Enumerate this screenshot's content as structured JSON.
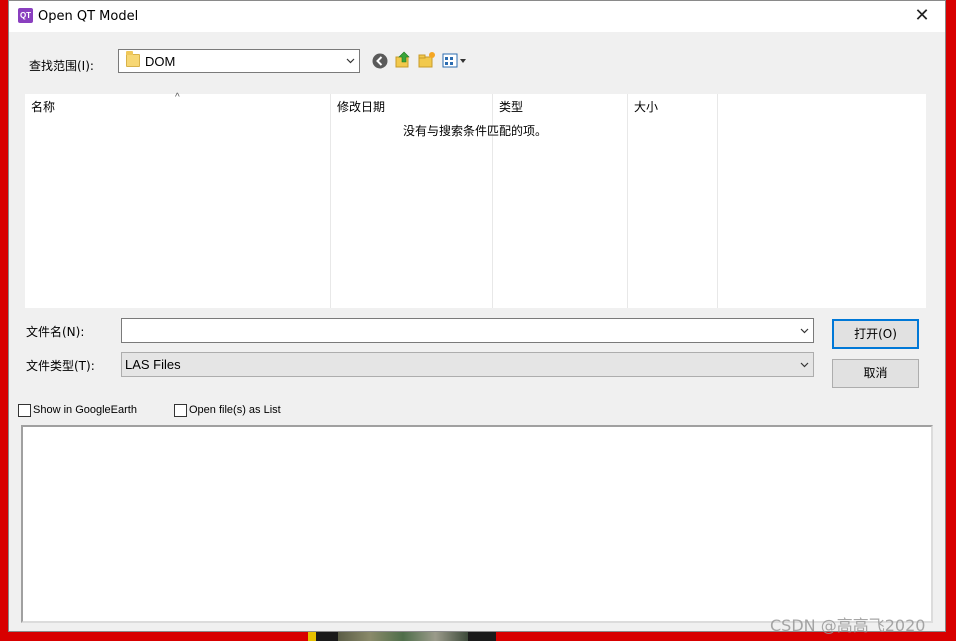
{
  "window": {
    "title": "Open QT Model",
    "app_icon_text": "QT",
    "close_glyph": "✕"
  },
  "lookin": {
    "label": "查找范围(I):",
    "value": "DOM"
  },
  "toolbar": {
    "icons": [
      "back-icon",
      "up-folder-icon",
      "new-folder-icon",
      "view-menu-icon"
    ]
  },
  "file_list": {
    "columns": [
      "名称",
      "修改日期",
      "类型",
      "大小"
    ],
    "empty_message": "没有与搜索条件匹配的项。"
  },
  "filename": {
    "label": "文件名(N):",
    "value": ""
  },
  "filetype": {
    "label": "文件类型(T):",
    "value": "LAS Files"
  },
  "buttons": {
    "open": "打开(O)",
    "cancel": "取消"
  },
  "options": {
    "google_earth": "Show in GoogleEarth",
    "as_list": "Open file(s) as List"
  },
  "watermark": "CSDN @高高飞2020",
  "colors": {
    "backdrop": "#d80000",
    "dialog_bg": "#f0f0f0",
    "default_button_border": "#0078d7",
    "app_icon": "#8a3fbf"
  }
}
